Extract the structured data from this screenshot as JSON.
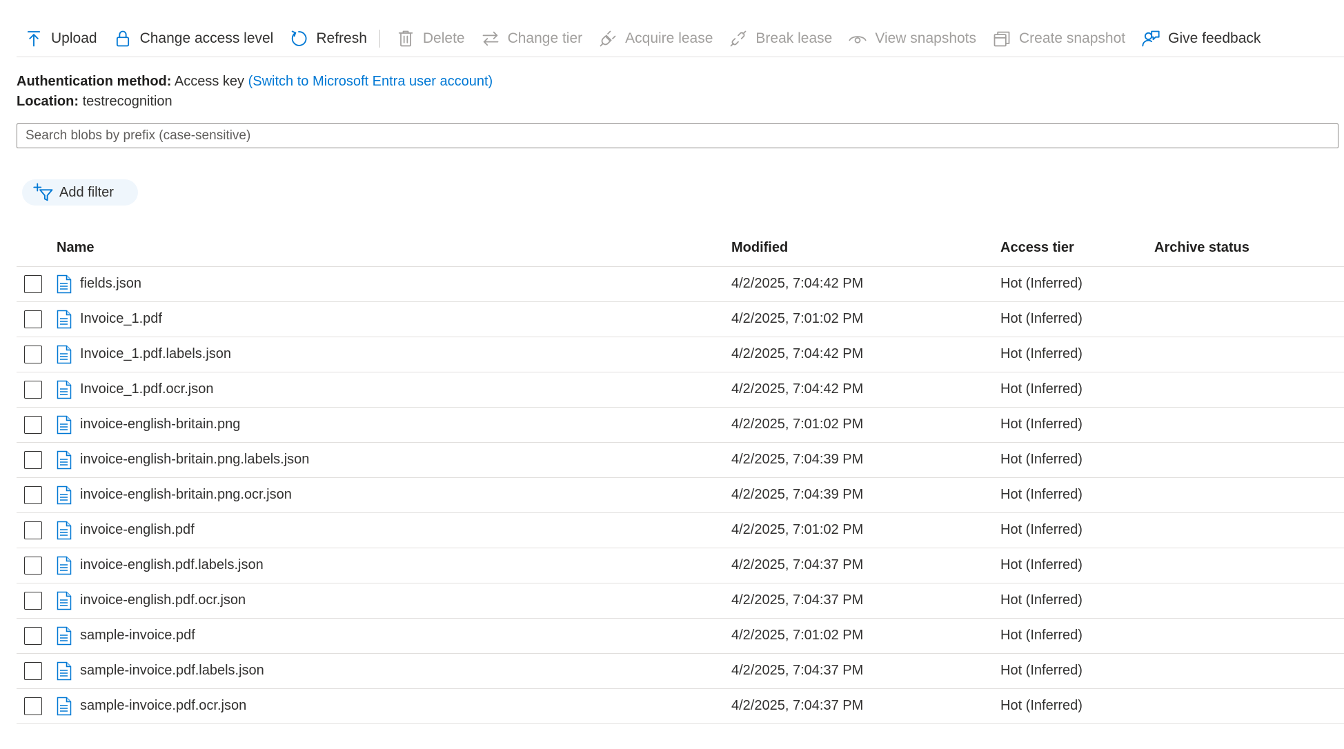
{
  "toolbar": {
    "upload": "Upload",
    "change_access_level": "Change access level",
    "refresh": "Refresh",
    "delete": "Delete",
    "change_tier": "Change tier",
    "acquire_lease": "Acquire lease",
    "break_lease": "Break lease",
    "view_snapshots": "View snapshots",
    "create_snapshot": "Create snapshot",
    "give_feedback": "Give feedback"
  },
  "info": {
    "auth_label": "Authentication method:",
    "auth_value": "Access key",
    "auth_link": "(Switch to Microsoft Entra user account)",
    "location_label": "Location:",
    "location_value": "testrecognition"
  },
  "search": {
    "placeholder": "Search blobs by prefix (case-sensitive)"
  },
  "filter": {
    "add_filter": "Add filter"
  },
  "table": {
    "headers": {
      "name": "Name",
      "modified": "Modified",
      "access_tier": "Access tier",
      "archive_status": "Archive status"
    },
    "rows": [
      {
        "name": "fields.json",
        "modified": "4/2/2025, 7:04:42 PM",
        "tier": "Hot (Inferred)"
      },
      {
        "name": "Invoice_1.pdf",
        "modified": "4/2/2025, 7:01:02 PM",
        "tier": "Hot (Inferred)"
      },
      {
        "name": "Invoice_1.pdf.labels.json",
        "modified": "4/2/2025, 7:04:42 PM",
        "tier": "Hot (Inferred)"
      },
      {
        "name": "Invoice_1.pdf.ocr.json",
        "modified": "4/2/2025, 7:04:42 PM",
        "tier": "Hot (Inferred)"
      },
      {
        "name": "invoice-english-britain.png",
        "modified": "4/2/2025, 7:01:02 PM",
        "tier": "Hot (Inferred)"
      },
      {
        "name": "invoice-english-britain.png.labels.json",
        "modified": "4/2/2025, 7:04:39 PM",
        "tier": "Hot (Inferred)"
      },
      {
        "name": "invoice-english-britain.png.ocr.json",
        "modified": "4/2/2025, 7:04:39 PM",
        "tier": "Hot (Inferred)"
      },
      {
        "name": "invoice-english.pdf",
        "modified": "4/2/2025, 7:01:02 PM",
        "tier": "Hot (Inferred)"
      },
      {
        "name": "invoice-english.pdf.labels.json",
        "modified": "4/2/2025, 7:04:37 PM",
        "tier": "Hot (Inferred)"
      },
      {
        "name": "invoice-english.pdf.ocr.json",
        "modified": "4/2/2025, 7:04:37 PM",
        "tier": "Hot (Inferred)"
      },
      {
        "name": "sample-invoice.pdf",
        "modified": "4/2/2025, 7:01:02 PM",
        "tier": "Hot (Inferred)"
      },
      {
        "name": "sample-invoice.pdf.labels.json",
        "modified": "4/2/2025, 7:04:37 PM",
        "tier": "Hot (Inferred)"
      },
      {
        "name": "sample-invoice.pdf.ocr.json",
        "modified": "4/2/2025, 7:04:37 PM",
        "tier": "Hot (Inferred)"
      }
    ]
  },
  "colors": {
    "accent": "#0078d4",
    "disabled": "#a19f9d",
    "border": "#e1dfdd",
    "pill": "#eff6fc"
  }
}
